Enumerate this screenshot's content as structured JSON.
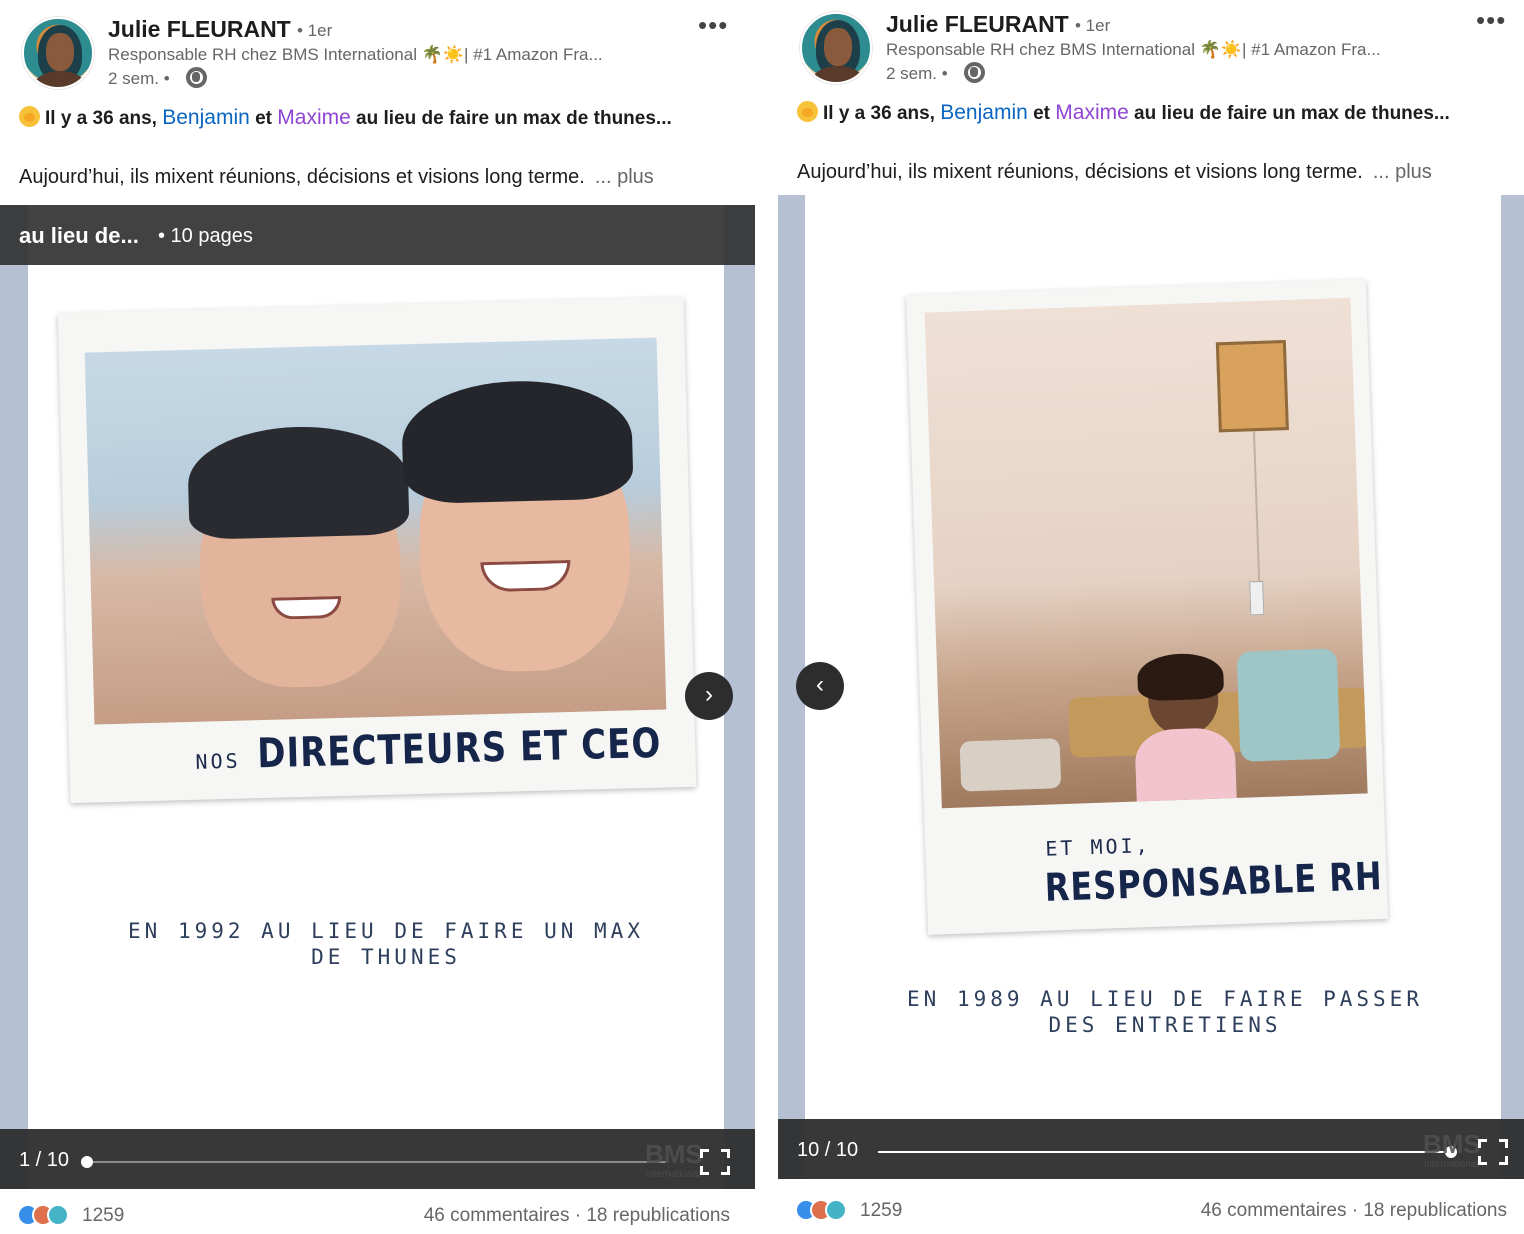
{
  "posts": [
    {
      "author": "Julie FLEURANT",
      "degree": "• 1er",
      "headline": "Responsable RH chez BMS International 🌴☀️| #1 Amazon Fra...",
      "time": "2 sem. •",
      "hook_prefix": "Il y a 36 ans, ",
      "mention1": "Benjamin",
      "hook_mid": " et ",
      "mention2": "Maxime",
      "hook_suffix": " au lieu de faire un max de thunes...",
      "body": "Aujourd’hui, ils mixent réunions, décisions et visions long terme.",
      "see_more": "... plus",
      "doc_title": "au lieu de...",
      "doc_pages": "• 10 pages",
      "slide": {
        "caption_small": "NOS",
        "caption_big": "DIRECTEURS ET CEO",
        "text_line1": "EN 1992 AU LIEU DE FAIRE UN MAX",
        "text_line2": "DE THUNES"
      },
      "pager": "1 / 10",
      "progress": 0.0,
      "nav": "›",
      "logo": "BMS",
      "logo_sub": "international",
      "reaction_count": "1259",
      "comments": "46 commentaires",
      "reposts": "18 republications"
    },
    {
      "author": "Julie FLEURANT",
      "degree": "• 1er",
      "headline": "Responsable RH chez BMS International 🌴☀️| #1 Amazon Fra...",
      "time": "2 sem. •",
      "hook_prefix": "Il y a 36 ans, ",
      "mention1": "Benjamin",
      "hook_mid": " et ",
      "mention2": "Maxime",
      "hook_suffix": " au lieu de faire un max de thunes...",
      "body": "Aujourd’hui, ils mixent réunions, décisions et visions long terme.",
      "see_more": "... plus",
      "slide": {
        "caption_small": "ET MOI,",
        "caption_big": "RESPONSABLE RH",
        "text_line1": "EN 1989 AU LIEU DE FAIRE PASSER",
        "text_line2": "DES ENTRETIENS"
      },
      "pager": "10 / 10",
      "progress": 1.0,
      "nav": "‹",
      "logo": "BMS",
      "logo_sub": "international",
      "reaction_count": "1259",
      "comments": "46 commentaires",
      "reposts": "18 republications"
    }
  ],
  "separator": "·"
}
